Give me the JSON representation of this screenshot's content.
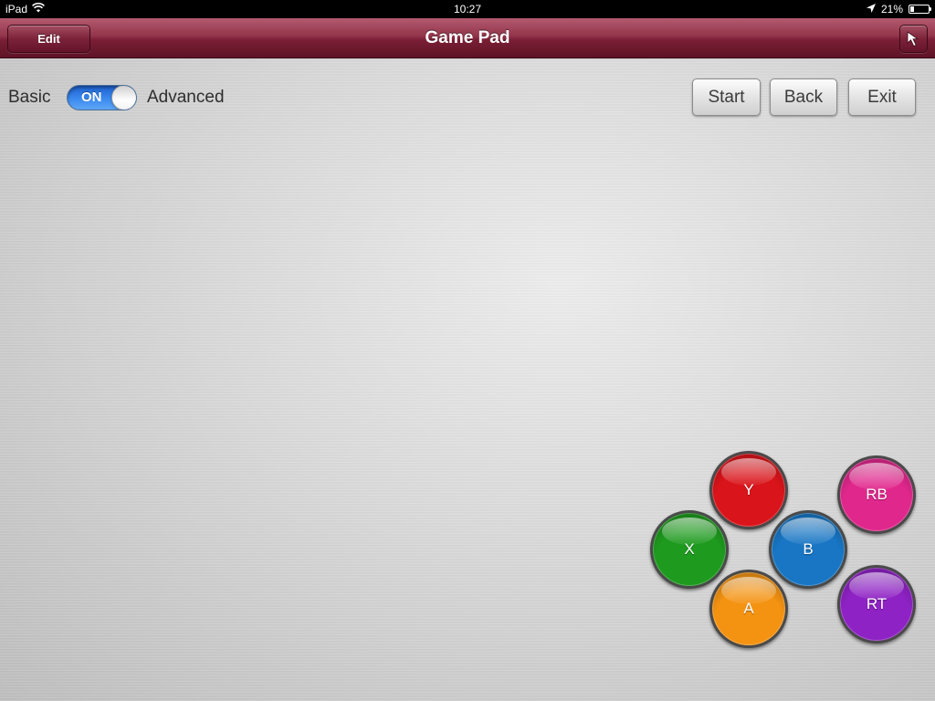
{
  "status_bar": {
    "device": "iPad",
    "time": "10:27",
    "battery": "21%",
    "battery_level": 0.21
  },
  "nav_bar": {
    "title": "Game Pad",
    "edit_label": "Edit",
    "pointer_icon": "cursor-arrow-icon"
  },
  "mode": {
    "basic_label": "Basic",
    "advanced_label": "Advanced",
    "toggle_state": "ON"
  },
  "actions": {
    "start": "Start",
    "back": "Back",
    "exit": "Exit"
  },
  "pad_buttons": {
    "y": {
      "label": "Y",
      "color": "#d9141a"
    },
    "x": {
      "label": "X",
      "color": "#1e9a1e"
    },
    "b": {
      "label": "B",
      "color": "#1876c4"
    },
    "a": {
      "label": "A",
      "color": "#f49312"
    },
    "rb": {
      "label": "RB",
      "color": "#e0278c"
    },
    "rt": {
      "label": "RT",
      "color": "#8e22c4"
    }
  }
}
